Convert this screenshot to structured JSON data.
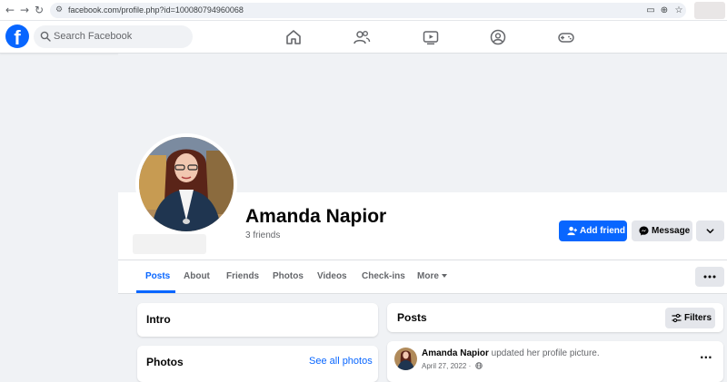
{
  "browser": {
    "url": "facebook.com/profile.php?id=100080794960068",
    "icons": [
      "back-icon",
      "forward-icon",
      "reload-icon",
      "site-info-icon",
      "cast-icon",
      "zoom-icon",
      "bookmark-star-icon"
    ]
  },
  "topnav": {
    "logo": "f",
    "search_placeholder": "Search Facebook",
    "tabs": [
      "home-icon",
      "friends-icon",
      "watch-icon",
      "groups-icon",
      "gaming-icon"
    ]
  },
  "profile": {
    "name": "Amanda Napior",
    "friends": "3 friends"
  },
  "actions": {
    "add_friend": "Add friend",
    "message": "Message"
  },
  "tabs": {
    "items": [
      "Posts",
      "About",
      "Friends",
      "Photos",
      "Videos",
      "Check-ins",
      "More"
    ],
    "active": "Posts"
  },
  "intro": {
    "title": "Intro"
  },
  "photos": {
    "title": "Photos",
    "see_all": "See all photos"
  },
  "posts": {
    "title": "Posts",
    "filters": "Filters",
    "first": {
      "author": "Amanda Napior",
      "text": " updated her profile picture.",
      "date": "April 27, 2022 ·"
    }
  },
  "colors": {
    "brand": "#0866ff",
    "background": "#f0f2f5",
    "secondary_button": "#e4e6eb"
  }
}
